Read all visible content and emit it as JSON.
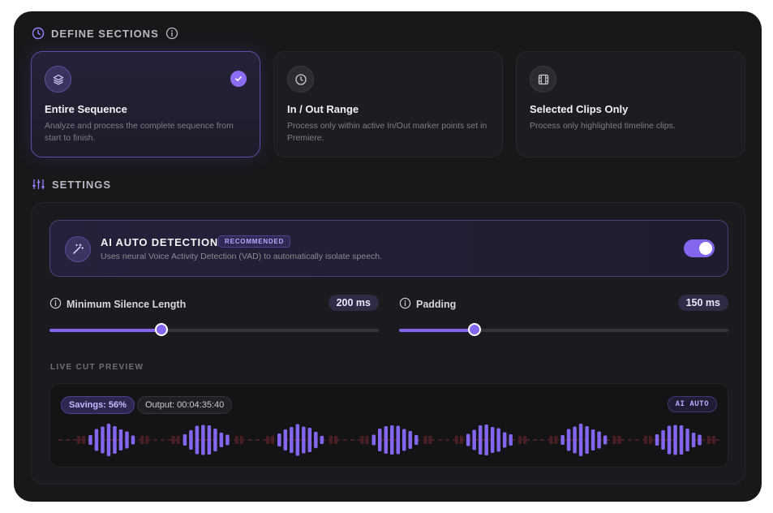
{
  "define_sections": {
    "title": "DEFINE SECTIONS",
    "options": [
      {
        "title": "Entire Sequence",
        "desc": "Analyze and process the complete sequence from start to finish.",
        "icon": "layers-icon",
        "selected": true
      },
      {
        "title": "In / Out Range",
        "desc": "Process only within active In/Out marker points set in Premiere.",
        "icon": "clock-icon",
        "selected": false
      },
      {
        "title": "Selected Clips Only",
        "desc": "Process only highlighted timeline clips.",
        "icon": "film-icon",
        "selected": false
      }
    ]
  },
  "settings": {
    "title": "SETTINGS",
    "ai_detection": {
      "title": "AI AUTO DETECTION",
      "badge": "RECOMMENDED",
      "desc": "Uses neural Voice Activity Detection (VAD) to automatically isolate speech.",
      "enabled": true
    },
    "min_silence": {
      "label": "Minimum Silence Length",
      "value": "200 ms",
      "fraction": 0.34
    },
    "padding": {
      "label": "Padding",
      "value": "150 ms",
      "fraction": 0.23
    }
  },
  "preview": {
    "title": "LIVE CUT PREVIEW",
    "savings": "Savings: 56%",
    "output": "Output: 00:04:35:40",
    "mode": "AI AUTO",
    "speech_segments": 7
  },
  "colors": {
    "accent": "#8466ee",
    "panel": "#18181b",
    "cut": "#4a1f24"
  }
}
